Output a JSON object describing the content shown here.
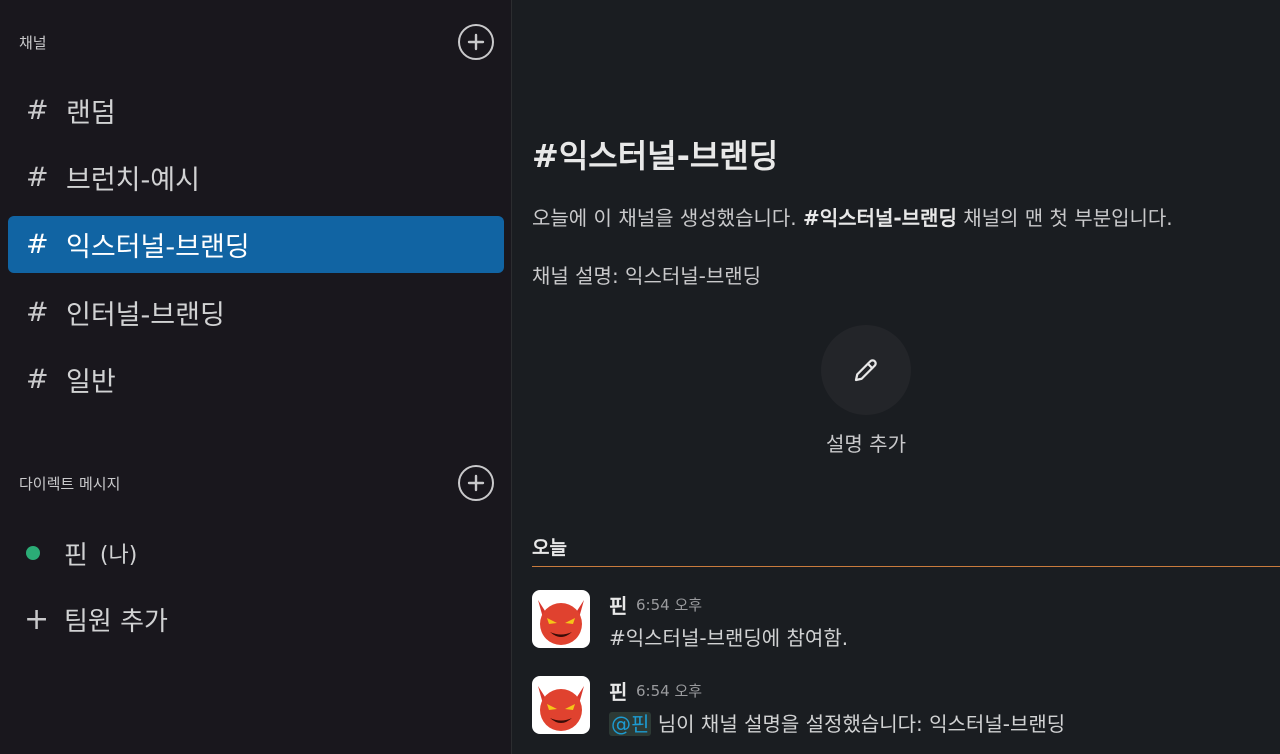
{
  "sidebar": {
    "channels_title": "채널",
    "channels": [
      {
        "hash": "#",
        "label": "랜덤"
      },
      {
        "hash": "#",
        "label": "브런치-예시"
      },
      {
        "hash": "#",
        "label": "익스터널-브랜딩"
      },
      {
        "hash": "#",
        "label": "인터널-브랜딩"
      },
      {
        "hash": "#",
        "label": "일반"
      }
    ],
    "active_channel": "익스터널-브랜딩",
    "dm_title": "다이렉트 메시지",
    "dms": [
      {
        "label": "핀",
        "suffix": "(나)",
        "status_color": "#2bac76"
      }
    ],
    "add_member_icon": "+",
    "add_member_label": "팀원 추가"
  },
  "main": {
    "channel_title": "#익스터널-브랜딩",
    "intro_prefix": "오늘에 이 채널을 생성했습니다.",
    "intro_channel": "#익스터널-브랜딩",
    "intro_suffix": "채널의 맨 첫 부분입니다.",
    "description": "채널 설명: 익스터널-브랜딩",
    "add_description_label": "설명 추가",
    "day_divider": "오늘",
    "messages": [
      {
        "author": "핀",
        "time": "6:54 오후",
        "text": "#익스터널-브랜딩에 참여함."
      },
      {
        "author": "핀",
        "time": "6:54 오후",
        "mention": "@핀",
        "text": "님이 채널 설명을 설정했습니다: 익스터널-브랜딩"
      }
    ]
  },
  "colors": {
    "sidebar_bg": "#19171d",
    "main_bg": "#1a1d21",
    "active_item": "#1164a3",
    "online_dot": "#2bac76",
    "divider_line": "#c97b3d",
    "mention_text": "#1d9bd1"
  },
  "icons": {
    "add_channel": "plus-circle-icon",
    "add_dm": "plus-circle-icon",
    "edit": "pencil-icon",
    "avatar": "devil-face-icon"
  }
}
